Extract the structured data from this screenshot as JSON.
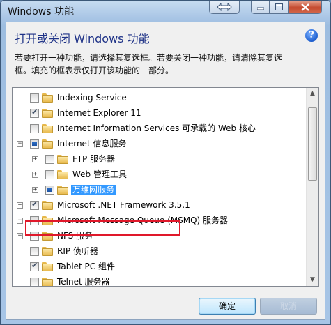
{
  "window": {
    "title": "Windows 功能",
    "controls": [
      "arrows-icon",
      "minimize-icon",
      "maximize-icon",
      "close-icon"
    ]
  },
  "header": {
    "title": "打开或关闭 Windows 功能",
    "help_icon": "help-icon",
    "help_glyph": "?"
  },
  "description": {
    "line1": "若要打开一种功能，请选择其复选框。若要关闭一种功能，请清除其复选",
    "line2": "框。填充的框表示仅打开该功能的一部分。"
  },
  "features": [
    {
      "label": "Indexing Service",
      "state": "unchecked",
      "expander": "",
      "level": 0
    },
    {
      "label": "Internet Explorer 11",
      "state": "checked",
      "expander": "",
      "level": 0
    },
    {
      "label": "Internet Information Services 可承载的 Web 核心",
      "state": "unchecked",
      "expander": "",
      "level": 0
    },
    {
      "label": "Internet 信息服务",
      "state": "partial",
      "expander": "−",
      "level": 0,
      "highlighted": true
    },
    {
      "label": "FTP 服务器",
      "state": "unchecked",
      "expander": "+",
      "level": 1
    },
    {
      "label": "Web 管理工具",
      "state": "unchecked",
      "expander": "+",
      "level": 1
    },
    {
      "label": "万维网服务",
      "state": "partial",
      "expander": "+",
      "level": 1,
      "selected": true
    },
    {
      "label": "Microsoft .NET Framework 3.5.1",
      "state": "checked",
      "expander": "+",
      "level": 0
    },
    {
      "label": "Microsoft Message Queue (MSMQ) 服务器",
      "state": "unchecked",
      "expander": "+",
      "level": 0
    },
    {
      "label": "NFS 服务",
      "state": "unchecked",
      "expander": "+",
      "level": 0
    },
    {
      "label": "RIP 侦听器",
      "state": "unchecked",
      "expander": "",
      "level": 0
    },
    {
      "label": "Tablet PC 组件",
      "state": "checked",
      "expander": "",
      "level": 0
    },
    {
      "label": "Telnet 服务器",
      "state": "unchecked",
      "expander": "",
      "level": 0
    }
  ],
  "scrollbar": {
    "up_glyph": "▲",
    "down_glyph": "▼"
  },
  "buttons": {
    "ok": "确定",
    "cancel": "取消"
  },
  "colors": {
    "highlight_border": "#e0182a",
    "selection": "#3399ff",
    "header_text": "#1e3287"
  }
}
